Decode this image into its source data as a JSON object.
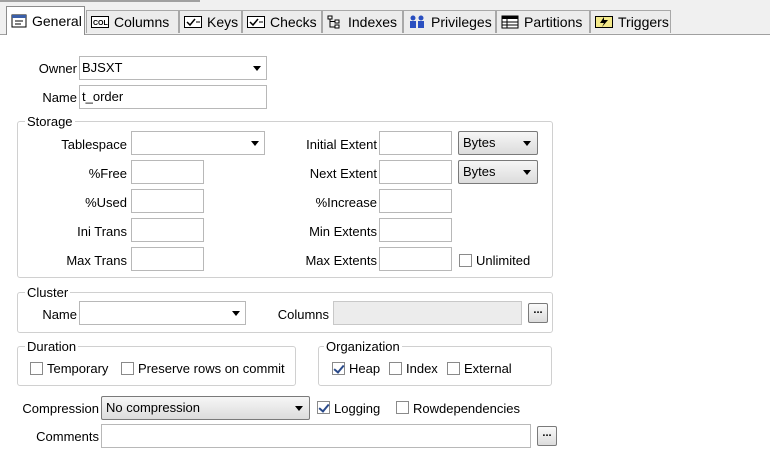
{
  "tabs": [
    {
      "label": "General",
      "icon": "general-icon"
    },
    {
      "label": "Columns",
      "icon": "columns-icon"
    },
    {
      "label": "Keys",
      "icon": "keys-icon"
    },
    {
      "label": "Checks",
      "icon": "checks-icon"
    },
    {
      "label": "Indexes",
      "icon": "indexes-icon"
    },
    {
      "label": "Privileges",
      "icon": "privileges-icon"
    },
    {
      "label": "Partitions",
      "icon": "partitions-icon"
    },
    {
      "label": "Triggers",
      "icon": "triggers-icon"
    }
  ],
  "general": {
    "owner_label": "Owner",
    "owner_value": "BJSXT",
    "name_label": "Name",
    "name_value": "t_order"
  },
  "storage": {
    "title": "Storage",
    "tablespace_label": "Tablespace",
    "tablespace_value": "",
    "free_label": "%Free",
    "used_label": "%Used",
    "ini_trans_label": "Ini Trans",
    "max_trans_label": "Max Trans",
    "initial_extent_label": "Initial Extent",
    "initial_extent_unit": "Bytes",
    "next_extent_label": "Next Extent",
    "next_extent_unit": "Bytes",
    "increase_label": "%Increase",
    "min_extents_label": "Min Extents",
    "max_extents_label": "Max Extents",
    "unlimited_label": "Unlimited",
    "unlimited_checked": false
  },
  "cluster": {
    "title": "Cluster",
    "name_label": "Name",
    "name_value": "",
    "columns_label": "Columns",
    "columns_value": "",
    "browse_label": "..."
  },
  "duration": {
    "title": "Duration",
    "temporary_label": "Temporary",
    "temporary_checked": false,
    "preserve_label": "Preserve rows on commit",
    "preserve_checked": false
  },
  "organization": {
    "title": "Organization",
    "heap_label": "Heap",
    "heap_checked": true,
    "index_label": "Index",
    "index_checked": false,
    "external_label": "External",
    "external_checked": false
  },
  "compression": {
    "label": "Compression",
    "value": "No compression",
    "logging_label": "Logging",
    "logging_checked": true,
    "rowdep_label": "Rowdependencies",
    "rowdep_checked": false
  },
  "comments": {
    "label": "Comments",
    "value": "",
    "browse_label": "..."
  }
}
